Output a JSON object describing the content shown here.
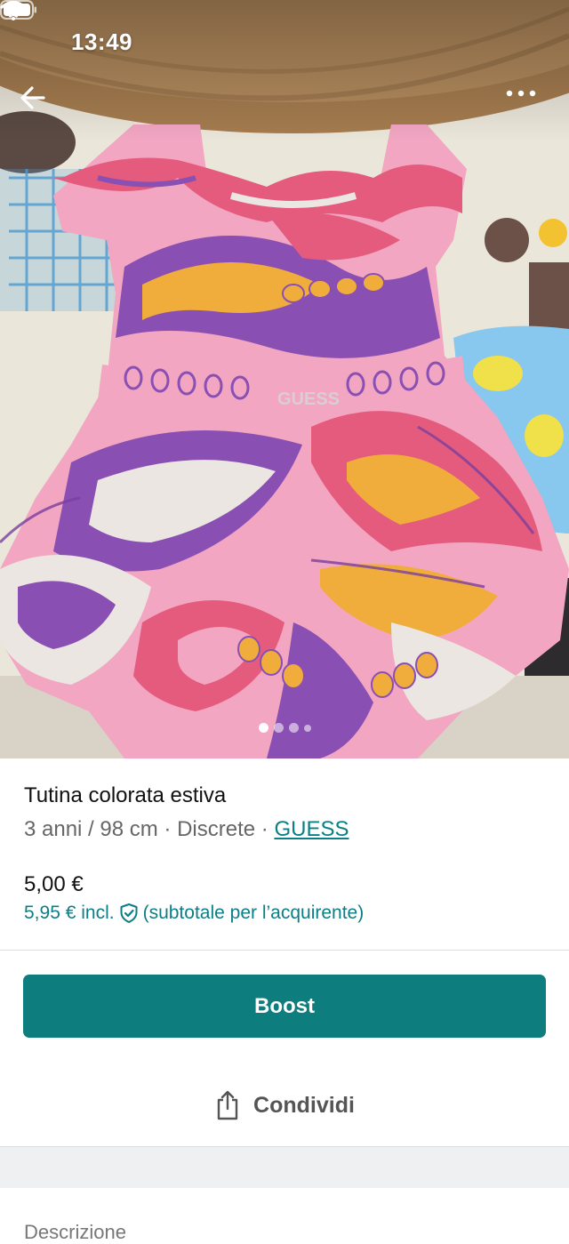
{
  "status_bar": {
    "time": "13:49"
  },
  "header": {
    "back_icon": "arrow-left-icon",
    "more_icon": "more-horizontal-icon"
  },
  "gallery": {
    "photo_count": 4,
    "current_photo": 1
  },
  "item": {
    "title": "Tutina colorata estiva",
    "size": "3 anni / 98 cm",
    "separator": " · ",
    "condition": "Discrete",
    "brand": "GUESS",
    "price": "5,00 €",
    "price_incl": "5,95 € incl.",
    "buyer_protection_icon": "shield-check-icon",
    "price_incl_note": "(subtotale per l’acquirente)"
  },
  "actions": {
    "boost_label": "Boost",
    "share_label": "Condividi",
    "share_icon": "share-icon"
  },
  "description": {
    "heading": "Descrizione"
  },
  "colors": {
    "accent": "#0e7d7e",
    "link": "#0b7e86"
  }
}
